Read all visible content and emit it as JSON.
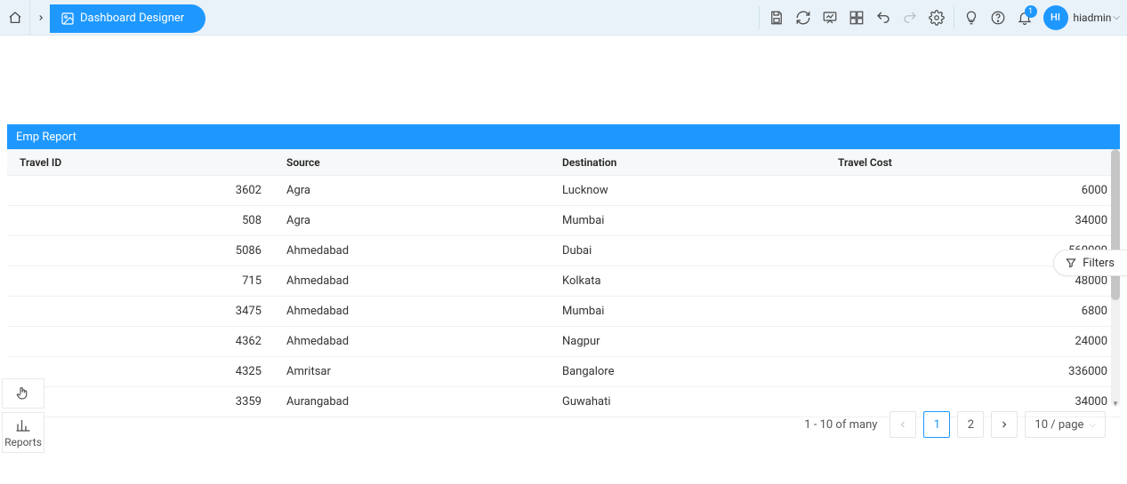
{
  "breadcrumb": {
    "current": "Dashboard Designer"
  },
  "toolbar_right": {
    "notification_count": "1"
  },
  "user": {
    "initials": "HI",
    "name": "hiadmin"
  },
  "report": {
    "title": "Emp Report",
    "columns": {
      "c1": "Travel ID",
      "c2": "Source",
      "c3": "Destination",
      "c4": "Travel Cost"
    },
    "rows": [
      {
        "id": "3602",
        "src": "Agra",
        "dest": "Lucknow",
        "cost": "6000"
      },
      {
        "id": "508",
        "src": "Agra",
        "dest": "Mumbai",
        "cost": "34000"
      },
      {
        "id": "5086",
        "src": "Ahmedabad",
        "dest": "Dubai",
        "cost": "560000"
      },
      {
        "id": "715",
        "src": "Ahmedabad",
        "dest": "Kolkata",
        "cost": "48000"
      },
      {
        "id": "3475",
        "src": "Ahmedabad",
        "dest": "Mumbai",
        "cost": "6800"
      },
      {
        "id": "4362",
        "src": "Ahmedabad",
        "dest": "Nagpur",
        "cost": "24000"
      },
      {
        "id": "4325",
        "src": "Amritsar",
        "dest": "Bangalore",
        "cost": "336000"
      },
      {
        "id": "3359",
        "src": "Aurangabad",
        "dest": "Guwahati",
        "cost": "34000"
      }
    ]
  },
  "filters_pill": {
    "label": "Filters"
  },
  "pagination": {
    "info": "1 - 10 of many",
    "page_1": "1",
    "page_2": "2",
    "size_label": "10 / page"
  },
  "float": {
    "reports_label": "Reports"
  }
}
